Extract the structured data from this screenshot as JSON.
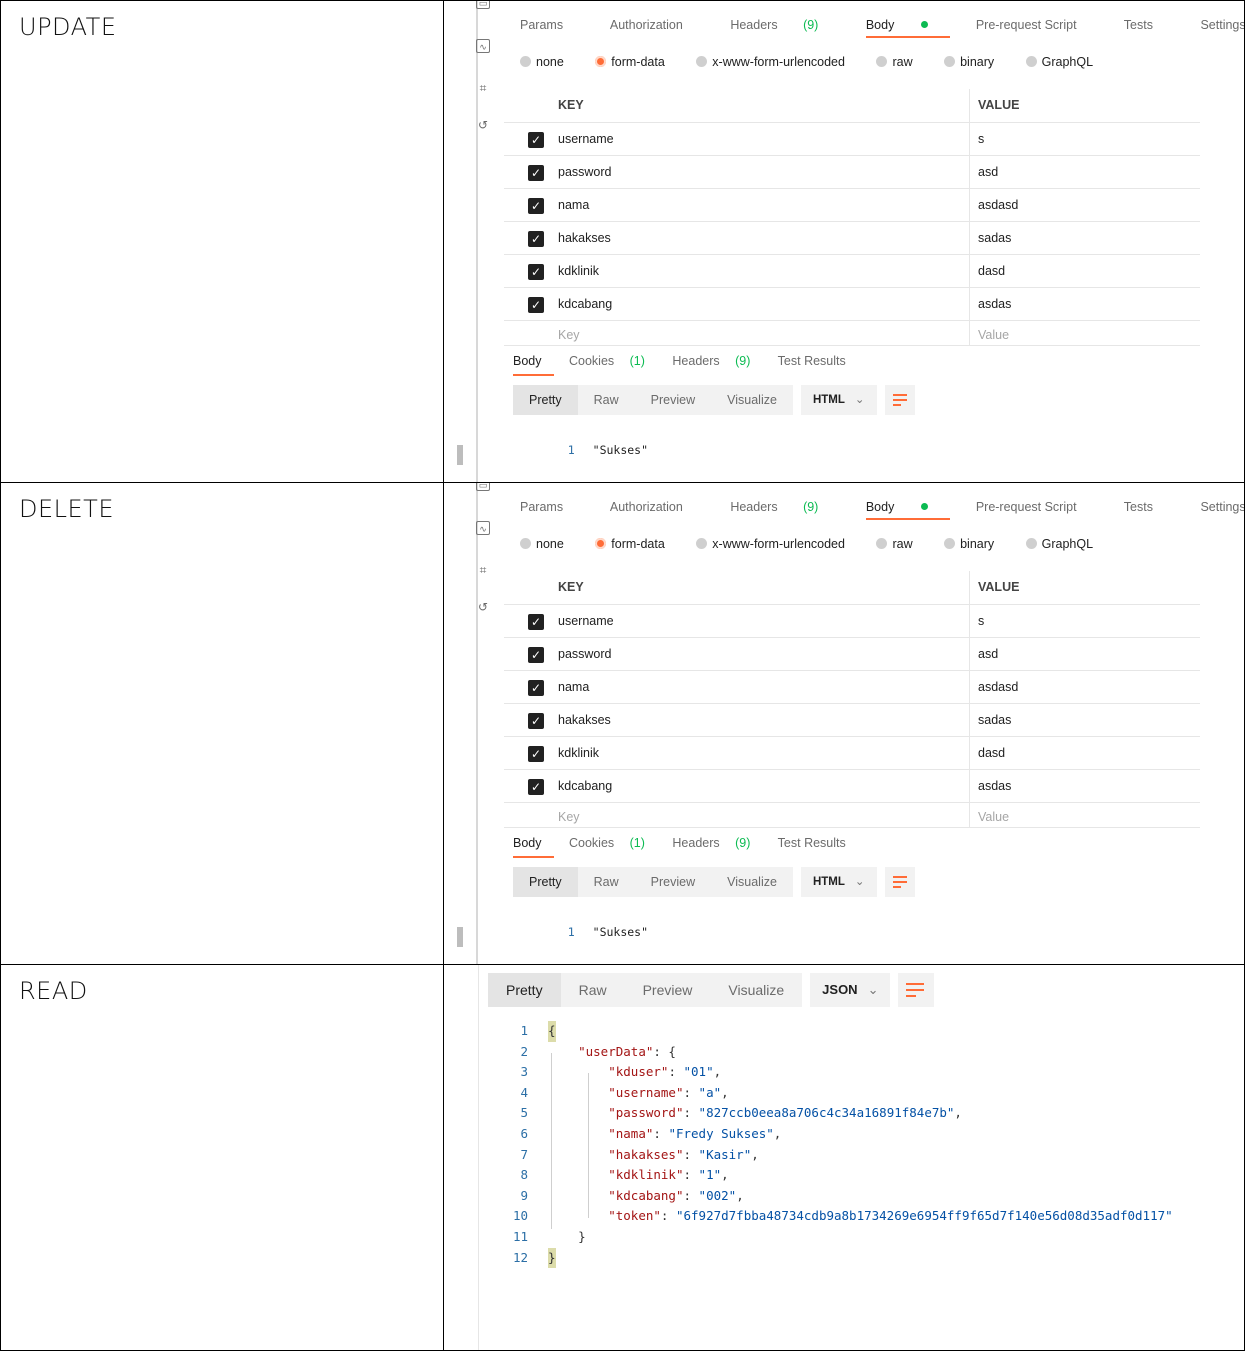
{
  "rows": [
    {
      "label": "UPDATE"
    },
    {
      "label": "DELETE"
    },
    {
      "label": "READ"
    }
  ],
  "request_tabs": [
    {
      "label": "Params"
    },
    {
      "label": "Authorization"
    },
    {
      "label": "Headers",
      "count": "(9)"
    },
    {
      "label": "Body"
    },
    {
      "label": "Pre-request Script"
    },
    {
      "label": "Tests"
    },
    {
      "label": "Settings"
    }
  ],
  "body_types": [
    "none",
    "form-data",
    "x-www-form-urlencoded",
    "raw",
    "binary",
    "GraphQL"
  ],
  "form_table": {
    "key_header": "KEY",
    "value_header": "VALUE",
    "rows": [
      {
        "key": "username",
        "value": "s"
      },
      {
        "key": "password",
        "value": "asd"
      },
      {
        "key": "nama",
        "value": "asdasd"
      },
      {
        "key": "hakakses",
        "value": "sadas"
      },
      {
        "key": "kdklinik",
        "value": "dasd"
      },
      {
        "key": "kdcabang",
        "value": "asdas"
      }
    ],
    "key_placeholder": "Key",
    "value_placeholder": "Value"
  },
  "response_tabs": [
    {
      "label": "Body",
      "count": ""
    },
    {
      "label": "Cookies",
      "count": "(1)"
    },
    {
      "label": "Headers",
      "count": "(9)"
    },
    {
      "label": "Test Results",
      "count": ""
    }
  ],
  "view_modes": [
    "Pretty",
    "Raw",
    "Preview",
    "Visualize"
  ],
  "format_html": "HTML",
  "format_json": "JSON",
  "response_text": {
    "line": "1",
    "text": "\"Sukses\""
  },
  "read_json_lines": [
    {
      "n": "1",
      "text": "{"
    },
    {
      "n": "2",
      "key": "\"userData\"",
      "rest": ": {"
    },
    {
      "n": "3",
      "key": "\"kduser\"",
      "val": "\"01\"",
      "end": ","
    },
    {
      "n": "4",
      "key": "\"username\"",
      "val": "\"a\"",
      "end": ","
    },
    {
      "n": "5",
      "key": "\"password\"",
      "val": "\"827ccb0eea8a706c4c34a16891f84e7b\"",
      "end": ","
    },
    {
      "n": "6",
      "key": "\"nama\"",
      "val": "\"Fredy Sukses\"",
      "end": ","
    },
    {
      "n": "7",
      "key": "\"hakakses\"",
      "val": "\"Kasir\"",
      "end": ","
    },
    {
      "n": "8",
      "key": "\"kdklinik\"",
      "val": "\"1\"",
      "end": ","
    },
    {
      "n": "9",
      "key": "\"kdcabang\"",
      "val": "\"002\"",
      "end": ","
    },
    {
      "n": "10",
      "key": "\"token\"",
      "val": "\"6f927d7fbba48734cdb9a8b1734269e6954ff9f65d7f140e56d08d35adf0d117\"",
      "end": ""
    },
    {
      "n": "11",
      "text": "}"
    },
    {
      "n": "12",
      "text": "}"
    }
  ],
  "colors": {
    "accent": "#ff6c37",
    "success": "#0cbb52",
    "json_key": "#a31515",
    "json_string": "#0451a5"
  },
  "icons": [
    "code-icon",
    "activity-icon",
    "graph-icon",
    "history-icon",
    "wrap-lines-icon",
    "checkbox-checked-icon",
    "chevron-down-icon"
  ]
}
